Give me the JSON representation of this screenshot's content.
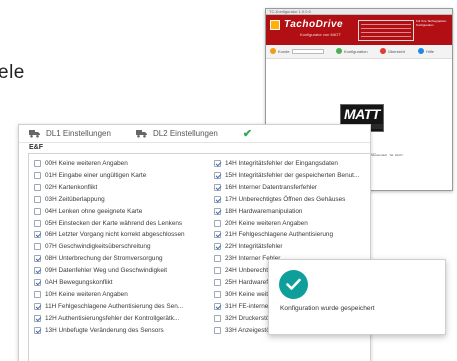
{
  "heading_fragment": "ele",
  "thumbnail": {
    "title_bar": "TC-Konfigurator 1.0.0.0",
    "logo": "TachoDrive",
    "logo_sub": "Konfigurator       von MATT",
    "header_note": "Für Ihre Tachographen Konfiguration",
    "steps": [
      "Kunde",
      "Konfiguration",
      "Übersicht",
      "Hilfe"
    ],
    "badge": "MATT",
    "badge_sub": "1904",
    "section": "Kontakt",
    "address": "Fahrtenschreiber-Service MATT · Musterstraße 1 · 12345 Musterstadt · Tel. 0123 / 456789 · info@example.de"
  },
  "tabs": [
    {
      "label": "DL1 Einstellungen",
      "icon": "truck-icon"
    },
    {
      "label": "DL2 Einstellungen",
      "icon": "truck-icon"
    }
  ],
  "section_title": "E&F",
  "left_items": [
    {
      "label": "00H Keine weiteren Angaben",
      "checked": false
    },
    {
      "label": "01H Eingabe einer ungültigen Karte",
      "checked": false
    },
    {
      "label": "02H Kartenkonflikt",
      "checked": false
    },
    {
      "label": "03H Zeitüberlappung",
      "checked": false
    },
    {
      "label": "04H Lenken ohne geeignete Karte",
      "checked": false
    },
    {
      "label": "05H Einstecken der Karte während des Lenkens",
      "checked": false
    },
    {
      "label": "06H Letzter Vorgang nicht korrekt abgeschlossen",
      "checked": true
    },
    {
      "label": "07H Geschwindigkeitsüberschreitung",
      "checked": false
    },
    {
      "label": "08H Unterbrechung der Stromversorgung",
      "checked": true
    },
    {
      "label": "09H Datenfehler Weg und Geschwindigkeit",
      "checked": true
    },
    {
      "label": "0AH Bewegungskonflikt",
      "checked": true
    },
    {
      "label": "10H Keine weiteren Angaben",
      "checked": false
    },
    {
      "label": "11H Fehlgeschlagene Authentisierung des Sen...",
      "checked": true
    },
    {
      "label": "12H Authentisierungsfehler der Kontrollgerätk...",
      "checked": true
    },
    {
      "label": "13H Unbefugte Veränderung des Sensors",
      "checked": true
    }
  ],
  "right_items": [
    {
      "label": "14H Integritätsfehler der Eingangsdaten",
      "checked": true
    },
    {
      "label": "15H Integritätsfehler der gespeicherten Benut...",
      "checked": true
    },
    {
      "label": "16H Interner Datentransferfehler",
      "checked": true
    },
    {
      "label": "17H Unberechtigtes Öffnen des Gehäuses",
      "checked": true
    },
    {
      "label": "18H Hardwaremanipulation",
      "checked": true
    },
    {
      "label": "20H Keine weiteren Angaben",
      "checked": false
    },
    {
      "label": "21H Fehlgeschlagene Authentisierung",
      "checked": true
    },
    {
      "label": "22H Integritätsfehler",
      "checked": true
    },
    {
      "label": "23H Interner Fehler",
      "checked": false
    },
    {
      "label": "24H Unberechtigter Zugriff",
      "checked": false
    },
    {
      "label": "25H Hardwarefehler",
      "checked": false
    },
    {
      "label": "30H Keine weiteren Angaben",
      "checked": false
    },
    {
      "label": "31H FE-interner Fehler",
      "checked": true
    },
    {
      "label": "32H Druckerstörung",
      "checked": false
    },
    {
      "label": "33H Anzeigestörung",
      "checked": false
    }
  ],
  "toast": {
    "message": "Konfiguration wurde gespeichert",
    "icon": "check-circle-icon"
  },
  "colors": {
    "brand_red": "#b10f14",
    "accent_teal": "#0e9f9b",
    "tab_check": "#34a853",
    "checkbox_tick": "#3b6fb6"
  }
}
